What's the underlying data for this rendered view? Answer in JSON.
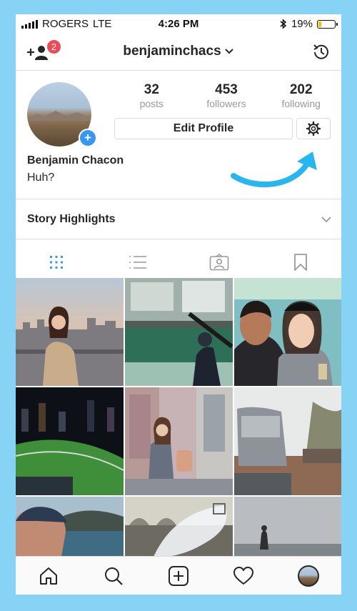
{
  "status_bar": {
    "carrier": "ROGERS",
    "network": "LTE",
    "time": "4:26 PM",
    "battery": "19%",
    "battery_level": 0.19
  },
  "header": {
    "username": "benjaminchacs",
    "notification_count": "2",
    "icons": [
      "add-user-icon",
      "chevron-down-icon",
      "history-icon"
    ]
  },
  "profile": {
    "stats": [
      {
        "value": "32",
        "label": "posts"
      },
      {
        "value": "453",
        "label": "followers"
      },
      {
        "value": "202",
        "label": "following"
      }
    ],
    "edit_label": "Edit Profile",
    "name": "Benjamin Chacon",
    "bio": "Huh?"
  },
  "highlights": {
    "label": "Story Highlights"
  },
  "tabs": [
    "grid-icon",
    "list-icon",
    "tagged-icon",
    "saved-icon"
  ],
  "bottom_nav": [
    "home-icon",
    "search-icon",
    "new-post-icon",
    "activity-icon",
    "profile-avatar"
  ],
  "colors": {
    "frame": "#86d3f5",
    "annotation_arrow": "#27b7ee",
    "badge": "#ed4956",
    "active_tab": "#3897f0"
  }
}
